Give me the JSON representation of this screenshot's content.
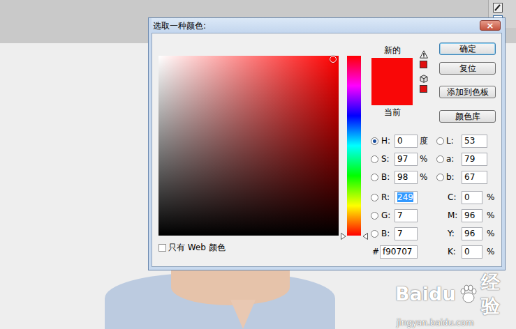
{
  "window": {
    "title": "选取一种颜色:",
    "close_glyph": "×"
  },
  "color_field": {
    "hue_color": "#ff0000",
    "saturation": 0.97,
    "brightness": 0.98
  },
  "hue_slider": {
    "level": 0
  },
  "preview": {
    "new_label": "新的",
    "current_label": "当前",
    "new_color": "#f90707",
    "current_color": "#f90707"
  },
  "gamut_alerts": [
    {
      "kind": "warning",
      "color": "#e01010"
    },
    {
      "kind": "cube",
      "color": "#e01010"
    }
  ],
  "buttons": [
    {
      "label": "确定",
      "default": true
    },
    {
      "label": "复位",
      "default": false
    },
    {
      "label": "添加到色板",
      "default": false
    },
    {
      "label": "颜色库",
      "default": false
    }
  ],
  "hsb_rgb_fields": [
    {
      "label": "H:",
      "value": "0",
      "unit": "度",
      "selected": true,
      "text_selected": false
    },
    {
      "label": "S:",
      "value": "97",
      "unit": "%",
      "selected": false,
      "text_selected": false
    },
    {
      "label": "B:",
      "value": "98",
      "unit": "%",
      "selected": false,
      "text_selected": false
    },
    {
      "label": "R:",
      "value": "249",
      "unit": "",
      "selected": false,
      "text_selected": true
    },
    {
      "label": "G:",
      "value": "7",
      "unit": "",
      "selected": false,
      "text_selected": false
    },
    {
      "label": "B:",
      "value": "7",
      "unit": "",
      "selected": false,
      "text_selected": false
    }
  ],
  "lab_fields": [
    {
      "label": "L:",
      "value": "53",
      "selected": false
    },
    {
      "label": "a:",
      "value": "79",
      "selected": false
    },
    {
      "label": "b:",
      "value": "67",
      "selected": false
    }
  ],
  "cmyk_fields": [
    {
      "label": "C:",
      "value": "0",
      "unit": "%"
    },
    {
      "label": "M:",
      "value": "96",
      "unit": "%"
    },
    {
      "label": "Y:",
      "value": "96",
      "unit": "%"
    },
    {
      "label": "K:",
      "value": "0",
      "unit": "%"
    }
  ],
  "hex": {
    "label": "#",
    "value": "f90707"
  },
  "web_only": {
    "label": "只有 Web 颜色",
    "checked": false
  },
  "watermark": {
    "brand": "Baidu",
    "product": "经验",
    "url": "jingyan.baidu.com"
  }
}
